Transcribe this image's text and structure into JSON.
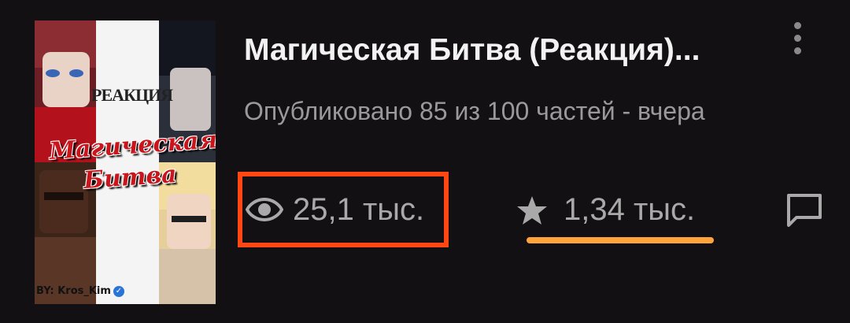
{
  "story": {
    "cover": {
      "label_top": "РЕАКЦИЯ",
      "title": "Магическая Битва",
      "author": "BY: Kros_Kim",
      "badge": "✓"
    },
    "title": "Магическая Битва (Реакция)...",
    "subtitle": "Опубликовано 85 из 100 частей - вчера",
    "views": "25,1 тыс.",
    "votes": "1,34 тыс."
  },
  "icons": {
    "menu": "more-vertical-icon",
    "views": "eye-icon",
    "votes": "star-icon",
    "comments": "comment-icon"
  },
  "colors": {
    "background": "#121013",
    "highlight_box": "#ff4713",
    "highlight_underline": "#ffa43a",
    "title_text": "#f2f2f2",
    "meta_text": "#9a9a9a"
  }
}
